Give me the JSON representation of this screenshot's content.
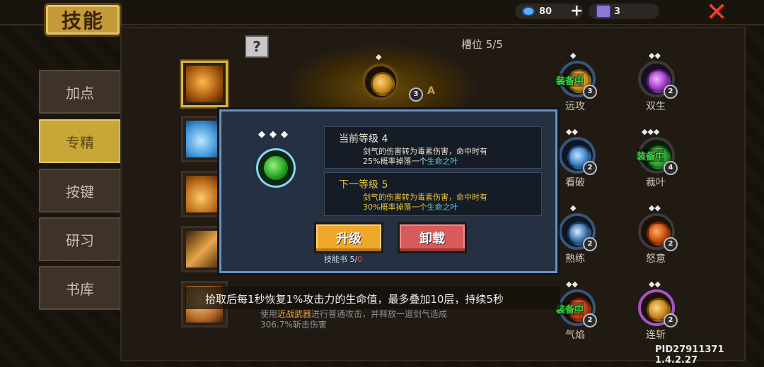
{
  "header": {
    "title": "技能",
    "gems": "80",
    "plus": "+",
    "materials": "3"
  },
  "sidebar": {
    "items": [
      {
        "label": "加点"
      },
      {
        "label": "专精"
      },
      {
        "label": "按键"
      },
      {
        "label": "研习"
      },
      {
        "label": "书库"
      }
    ],
    "active_index": 1
  },
  "help_label": "?",
  "slots_label": "槽位 5/5",
  "center_label": "A",
  "center_skill_level": "3",
  "skills": [
    {
      "name": "远攻",
      "level": "3",
      "equipped": "装备中"
    },
    {
      "name": "双生",
      "level": "2"
    },
    {
      "name": "看破",
      "level": "2"
    },
    {
      "name": "裁叶",
      "level": "4",
      "equipped": "装备中"
    },
    {
      "name": "熟练",
      "level": "2"
    },
    {
      "name": "怒意",
      "level": "2"
    },
    {
      "name": "气焰",
      "level": "2",
      "equipped": "装备中"
    },
    {
      "name": "连斩",
      "level": "2"
    }
  ],
  "dialog": {
    "diamonds": "◆◆◆",
    "current": {
      "title": "当前等级 4",
      "line1": "剑气的伤害转为毒素伤害，命中时有",
      "line2_pre": "25%概率掉落一个",
      "line2_link": "生命之叶"
    },
    "next": {
      "title": "下一等级 5",
      "line1": "剑气的伤害转为毒素伤害，命中时有",
      "line2_pre": "30%概率掉落一个",
      "line2_link": "生命之叶"
    },
    "upgrade_label": "升级",
    "unload_label": "卸载",
    "book_prefix": "技能书 5/",
    "book_have": "0"
  },
  "toast": "拾取后每1秒恢复1%攻击力的生命值，最多叠加10层，持续5秒",
  "description": {
    "pre": "使用",
    "link": "近战武器",
    "post": "进行普通攻击，并释放一道剑气造成",
    "line2": "306.7%斩击伤害"
  },
  "version": "PID27911371 1.4.2.27",
  "colors": {
    "accent_gold": "#c8a637",
    "equip_green": "#3fd14a",
    "upgrade": "#f0a82a",
    "unload": "#d85a5a",
    "link_cyan": "#5fd0e8",
    "next_yellow": "#e8c23a",
    "book_zero": "#e04a4a"
  }
}
